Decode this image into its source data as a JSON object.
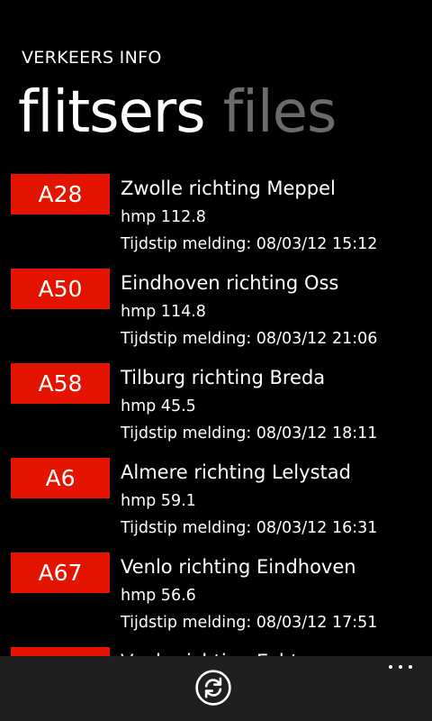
{
  "app": {
    "title": "VERKEERS INFO"
  },
  "pivot": {
    "tabs": [
      {
        "label": "flitsers"
      },
      {
        "label": "files"
      }
    ]
  },
  "items": [
    {
      "road": "A28",
      "route": "Zwolle richting Meppel",
      "hmp": "hmp 112.8",
      "time": "Tijdstip melding: 08/03/12 15:12"
    },
    {
      "road": "A50",
      "route": "Eindhoven richting Oss",
      "hmp": "hmp 114.8",
      "time": "Tijdstip melding: 08/03/12 21:06"
    },
    {
      "road": "A58",
      "route": "Tilburg richting Breda",
      "hmp": "hmp 45.5",
      "time": "Tijdstip melding: 08/03/12 18:11"
    },
    {
      "road": "A6",
      "route": "Almere richting Lelystad",
      "hmp": "hmp 59.1",
      "time": "Tijdstip melding: 08/03/12 16:31"
    },
    {
      "road": "A67",
      "route": "Venlo richting Eindhoven",
      "hmp": "hmp 56.6",
      "time": "Tijdstip melding: 08/03/12 17:51"
    },
    {
      "road": "",
      "route": "Venlo richting Echt",
      "hmp": "",
      "time": ""
    }
  ],
  "appbar": {
    "refresh_icon": "refresh-icon",
    "more_icon": "more-icon"
  },
  "colors": {
    "accent": "#e51400",
    "inactive_tab": "#6b6b6b",
    "appbar": "#1f1f1f"
  }
}
